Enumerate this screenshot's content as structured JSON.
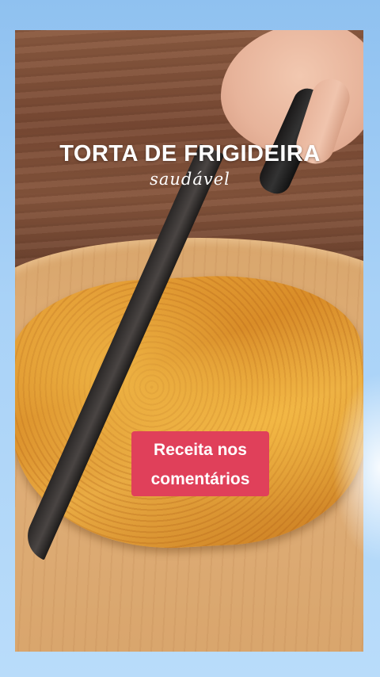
{
  "video": {
    "title": "TORTA DE FRIGIDEIRA",
    "subtitle": "saudável",
    "caption_line1": "Receita nos",
    "caption_line2": "comentários"
  },
  "colors": {
    "background": "#a9d2f7",
    "caption_bg": "#e0405a",
    "text": "#ffffff"
  }
}
